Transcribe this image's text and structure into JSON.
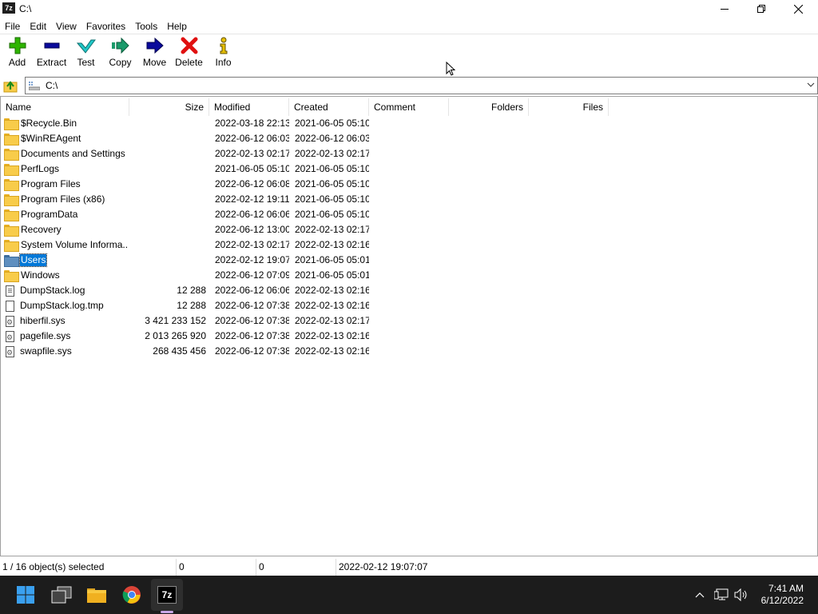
{
  "window": {
    "title": "C:\\",
    "app_icon": "7z"
  },
  "menu": [
    "File",
    "Edit",
    "View",
    "Favorites",
    "Tools",
    "Help"
  ],
  "toolbar": [
    {
      "label": "Add",
      "icon": "plus-icon",
      "color": "#2db400"
    },
    {
      "label": "Extract",
      "icon": "minus-icon",
      "color": "#0a0a9c"
    },
    {
      "label": "Test",
      "icon": "check-icon",
      "color": "#20c0c0"
    },
    {
      "label": "Copy",
      "icon": "copy-arrow-icon",
      "color": "#1a9a6a"
    },
    {
      "label": "Move",
      "icon": "move-arrow-icon",
      "color": "#0a0a9c"
    },
    {
      "label": "Delete",
      "icon": "delete-x-icon",
      "color": "#e01010"
    },
    {
      "label": "Info",
      "icon": "info-icon",
      "color": "#c8a000"
    }
  ],
  "address": {
    "path": "C:\\"
  },
  "columns": [
    "Name",
    "Size",
    "Modified",
    "Created",
    "Comment",
    "Folders",
    "Files"
  ],
  "rows": [
    {
      "name": "$Recycle.Bin",
      "type": "folder",
      "size": "",
      "modified": "2022-03-18 22:13",
      "created": "2021-06-05 05:10"
    },
    {
      "name": "$WinREAgent",
      "type": "folder",
      "size": "",
      "modified": "2022-06-12 06:03",
      "created": "2022-06-12 06:03"
    },
    {
      "name": "Documents and Settings",
      "type": "folder",
      "size": "",
      "modified": "2022-02-13 02:17",
      "created": "2022-02-13 02:17"
    },
    {
      "name": "PerfLogs",
      "type": "folder",
      "size": "",
      "modified": "2021-06-05 05:10",
      "created": "2021-06-05 05:10"
    },
    {
      "name": "Program Files",
      "type": "folder",
      "size": "",
      "modified": "2022-06-12 06:08",
      "created": "2021-06-05 05:10"
    },
    {
      "name": "Program Files (x86)",
      "type": "folder",
      "size": "",
      "modified": "2022-02-12 19:11",
      "created": "2021-06-05 05:10"
    },
    {
      "name": "ProgramData",
      "type": "folder",
      "size": "",
      "modified": "2022-06-12 06:06",
      "created": "2021-06-05 05:10"
    },
    {
      "name": "Recovery",
      "type": "folder",
      "size": "",
      "modified": "2022-06-12 13:00",
      "created": "2022-02-13 02:17"
    },
    {
      "name": "System Volume Informa...",
      "type": "folder",
      "size": "",
      "modified": "2022-02-13 02:17",
      "created": "2022-02-13 02:16"
    },
    {
      "name": "Users",
      "type": "folder",
      "size": "",
      "modified": "2022-02-12 19:07",
      "created": "2021-06-05 05:01",
      "selected": true
    },
    {
      "name": "Windows",
      "type": "folder",
      "size": "",
      "modified": "2022-06-12 07:09",
      "created": "2021-06-05 05:01"
    },
    {
      "name": "DumpStack.log",
      "type": "text",
      "size": "12 288",
      "modified": "2022-06-12 06:06",
      "created": "2022-02-13 02:16"
    },
    {
      "name": "DumpStack.log.tmp",
      "type": "file",
      "size": "12 288",
      "modified": "2022-06-12 07:38",
      "created": "2022-02-13 02:16"
    },
    {
      "name": "hiberfil.sys",
      "type": "sys",
      "size": "3 421 233 152",
      "modified": "2022-06-12 07:38",
      "created": "2022-02-13 02:17"
    },
    {
      "name": "pagefile.sys",
      "type": "sys",
      "size": "2 013 265 920",
      "modified": "2022-06-12 07:38",
      "created": "2022-02-13 02:16"
    },
    {
      "name": "swapfile.sys",
      "type": "sys",
      "size": "268 435 456",
      "modified": "2022-06-12 07:38",
      "created": "2022-02-13 02:16"
    }
  ],
  "status": {
    "selection": "1 / 16 object(s) selected",
    "size": "0",
    "packed": "0",
    "modified": "2022-02-12 19:07:07"
  },
  "taskbar": {
    "apps": [
      "start-icon",
      "task-view-icon",
      "file-explorer-icon",
      "chrome-icon",
      "7zip-icon"
    ],
    "time": "7:41 AM",
    "date": "6/12/2022"
  },
  "colors": {
    "selection": "#0078d7",
    "taskbar": "#1c1c1c"
  }
}
